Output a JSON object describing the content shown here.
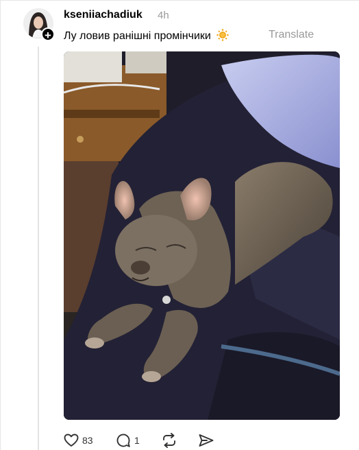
{
  "post": {
    "username": "kseniiachadiuk",
    "timestamp": "4h",
    "text": "Лу ловив ранішні промінчики",
    "translate_label": "Translate",
    "image_alt": "French bulldog basking in morning sun on a dark blanket",
    "icons": [
      "follow-plus-icon",
      "sun-emoji",
      "heart-icon",
      "comment-icon",
      "repost-icon",
      "share-icon"
    ]
  },
  "actions": {
    "likes": "83",
    "comments": "1"
  }
}
